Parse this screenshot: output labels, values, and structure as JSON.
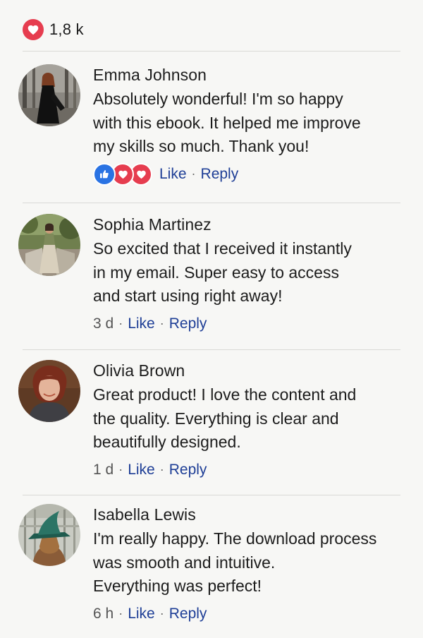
{
  "summary": {
    "icon": "heart-icon",
    "count": "1,8 k"
  },
  "colors": {
    "heart": "#e63d4f",
    "like": "#2a73e3",
    "link": "#1e3e96"
  },
  "comments": [
    {
      "author": "Emma Johnson",
      "lines": [
        "Absolutely wonderful! I'm so happy",
        "with this ebook. It helped me improve",
        "my skills so much. Thank you!"
      ],
      "time": "",
      "reactions": [
        "like-icon",
        "heart-icon",
        "heart-icon"
      ],
      "like_label": "Like",
      "reply_label": "Reply"
    },
    {
      "author": "Sophia Martinez",
      "lines": [
        "So excited that I received it instantly",
        "in my email. Super easy to access",
        "and start using right away!"
      ],
      "time": "3 d",
      "like_label": "Like",
      "reply_label": "Reply"
    },
    {
      "author": "Olivia Brown",
      "lines": [
        "Great product! I love the content and",
        "the quality. Everything is clear and",
        "beautifully designed."
      ],
      "time": "1 d",
      "like_label": "Like",
      "reply_label": "Reply"
    },
    {
      "author": "Isabella Lewis",
      "lines": [
        "I'm really happy. The download process",
        "was smooth and intuitive.",
        "Everything was perfect!"
      ],
      "time": "6 h",
      "like_label": "Like",
      "reply_label": "Reply"
    }
  ]
}
